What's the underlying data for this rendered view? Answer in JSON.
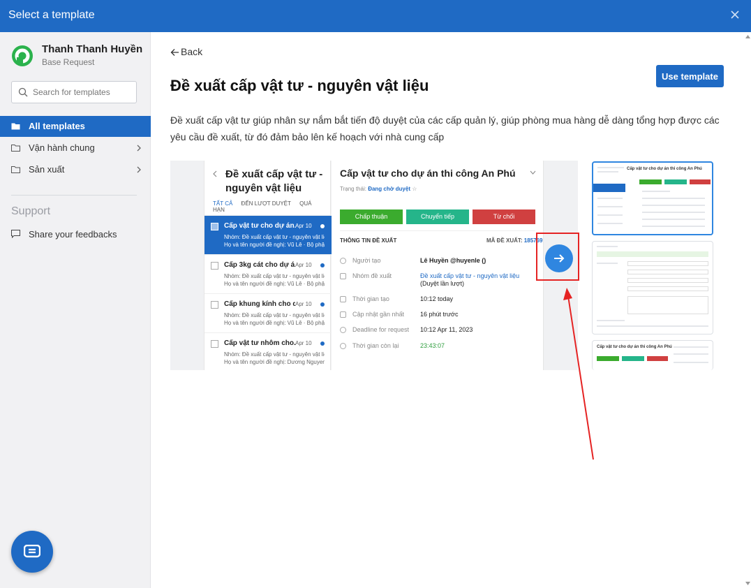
{
  "window": {
    "title": "Select a template"
  },
  "user": {
    "name": "Thanh Thanh Huyền",
    "app": "Base Request"
  },
  "search": {
    "placeholder": "Search for templates"
  },
  "nav": {
    "items": [
      {
        "label": "All templates"
      },
      {
        "label": "Vận hành chung"
      },
      {
        "label": "Sản xuất"
      }
    ],
    "support_heading": "Support",
    "feedback_label": "Share your feedbacks"
  },
  "main": {
    "back_label": "Back",
    "title": "Đề xuất cấp vật tư - nguyên vật liệu",
    "use_template_label": "Use template",
    "description": "Đề xuất cấp vật tư giúp nhân sự nắm bắt tiến độ duyệt của các cấp quản lý, giúp phòng mua hàng dễ dàng tổng hợp được các yêu cầu đề xuất, từ đó đảm bảo lên kế hoạch với nhà cung cấp"
  },
  "preview": {
    "list_title": "Đề xuất cấp vật tư - nguyên vật liệu",
    "tabs": [
      "TẤT CẢ",
      "ĐẾN LƯỢT DUYỆT",
      "QUÁ HẠN"
    ],
    "rows": [
      {
        "title": "Cấp vật tư cho dự án...",
        "date": "Apr 10",
        "line1": "Nhóm: Đề xuất cấp vật tư - nguyên vật liệu",
        "line2": "Họ và tên người đề nghị: Vũ Lê · Bộ phận:..."
      },
      {
        "title": "Cấp 3kg cát cho dự á...",
        "date": "Apr 10",
        "line1": "Nhóm: Đề xuất cấp vật tư - nguyên vật liệu ·",
        "line2": "Họ và tên người đề nghị: Vũ Lê · Bộ phận:..."
      },
      {
        "title": "Cấp khung kính cho d...",
        "date": "Apr 10",
        "line1": "Nhóm: Đề xuất cấp vật tư - nguyên vật liệu ·",
        "line2": "Họ và tên người đề nghị: Vũ Lê · Bộ phận:..."
      },
      {
        "title": "Cấp vật tư nhôm cho...",
        "date": "Apr 10",
        "line1": "Nhóm: Đề xuất cấp vật tư - nguyên vật liệu ·",
        "line2": "Họ và tên người đề nghị: Dương Nguyen · ..."
      }
    ],
    "detail_title": "Cấp vật tư cho dự án thi công An Phú",
    "status_label": "Trạng thái:",
    "status_value": "Đang chờ duyệt",
    "buttons": {
      "approve": "Chấp thuận",
      "forward": "Chuyển tiếp",
      "reject": "Từ chối"
    },
    "section_label": "THÔNG TIN ĐỀ XUẤT",
    "code_label": "MÃ ĐỀ XUẤT:",
    "code_value": "185769",
    "fields": [
      {
        "label": "Người tạo",
        "value": "Lê Huyền @huyenle ()"
      },
      {
        "label": "Nhóm đề xuất",
        "value": "Đề xuất cấp vật tư - nguyên vật liệu",
        "value_suffix": "(Duyệt lần lượt)"
      },
      {
        "label": "Thời gian tạo",
        "value": "10:12 today"
      },
      {
        "label": "Cập nhật gần nhất",
        "value": "16 phút trước"
      },
      {
        "label": "Deadline for request",
        "value": "10:12 Apr 11, 2023"
      },
      {
        "label": "Thời gian còn lại",
        "value": "23:43:07"
      }
    ],
    "thumb_titles": [
      "Cấp vật tư cho dự án thi công An Phú",
      "Cấp vật tư cho dự án thi công An Phú"
    ]
  },
  "colors": {
    "brand": "#1f6ac4",
    "approve": "#3bab2e",
    "forward": "#25b58a",
    "reject": "#d04040",
    "annotation": "#e52323"
  },
  "icons": {
    "close": "close-icon",
    "search": "search-icon",
    "folder": "folder-icon",
    "chevron": "chevron-right-icon",
    "feedback": "message-icon",
    "chat": "chat-icon",
    "back": "arrow-left-icon",
    "next": "arrow-right-icon"
  }
}
